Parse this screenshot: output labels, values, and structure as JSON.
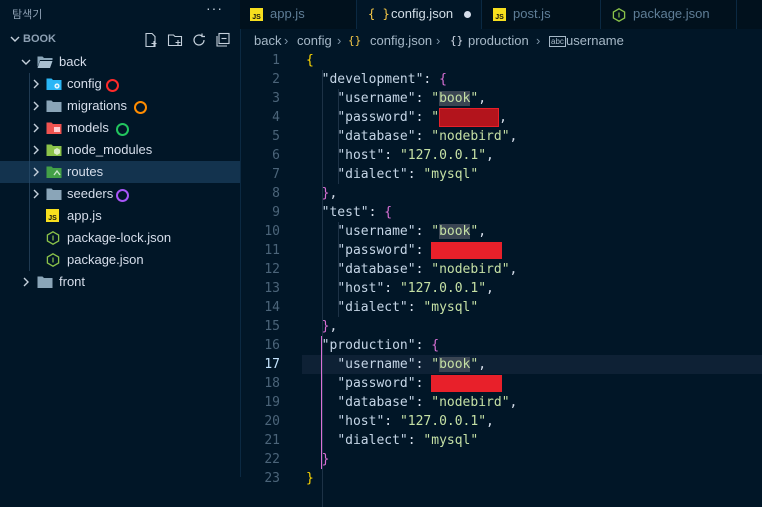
{
  "sidebar": {
    "explorer_title": "탐색기",
    "more_label": "···",
    "section_title": "BOOK",
    "items": [
      {
        "label": "back",
        "type": "folder-open",
        "color": "#8aa5b8"
      },
      {
        "label": "config",
        "type": "folder",
        "color": "#29b6f6",
        "dot": "#ff2a2a"
      },
      {
        "label": "migrations",
        "type": "folder",
        "color": "#8aa5b8",
        "dot": "#ff8c00"
      },
      {
        "label": "models",
        "type": "folder",
        "color": "#ef5350",
        "dot": "#22c55e"
      },
      {
        "label": "node_modules",
        "type": "folder",
        "color": "#8bc34a"
      },
      {
        "label": "routes",
        "type": "folder",
        "color": "#66bb6a"
      },
      {
        "label": "seeders",
        "type": "folder",
        "color": "#8aa5b8",
        "dot": "#a855f7"
      },
      {
        "label": "app.js",
        "type": "js"
      },
      {
        "label": "package-lock.json",
        "type": "node"
      },
      {
        "label": "package.json",
        "type": "node"
      },
      {
        "label": "front",
        "type": "folder",
        "color": "#8aa5b8"
      }
    ]
  },
  "tabs": [
    {
      "label": "app.js",
      "icon": "js-icon"
    },
    {
      "label": "config.json",
      "icon": "json-icon",
      "active": true,
      "modified": true
    },
    {
      "label": "post.js",
      "icon": "js-icon"
    },
    {
      "label": "package.json",
      "icon": "node-icon"
    }
  ],
  "breadcrumb": {
    "parts": [
      "back",
      "config",
      "config.json",
      "production",
      "username"
    ]
  },
  "editor": {
    "current_line": 17,
    "line_numbers": [
      "1",
      "2",
      "3",
      "4",
      "5",
      "6",
      "7",
      "8",
      "9",
      "10",
      "11",
      "12",
      "13",
      "14",
      "15",
      "16",
      "17",
      "18",
      "19",
      "20",
      "21",
      "22",
      "23"
    ],
    "environments": [
      {
        "name": "\"development\"",
        "username": "\"book\"",
        "database": "\"nodebird\"",
        "host": "\"127.0.0.1\"",
        "dialect": "\"mysql\""
      },
      {
        "name": "\"test\"",
        "username": "\"book\"",
        "database": "\"nodebird\"",
        "host": "\"127.0.0.1\"",
        "dialect": "\"mysql\""
      },
      {
        "name": "\"production\"",
        "username": "\"book\"",
        "database": "\"nodebird\"",
        "host": "\"127.0.0.1\"",
        "dialect": "\"mysql\""
      }
    ],
    "keys": {
      "username": "\"username\"",
      "password": "\"password\"",
      "database": "\"database\"",
      "host": "\"host\"",
      "dialect": "\"dialect\""
    }
  }
}
